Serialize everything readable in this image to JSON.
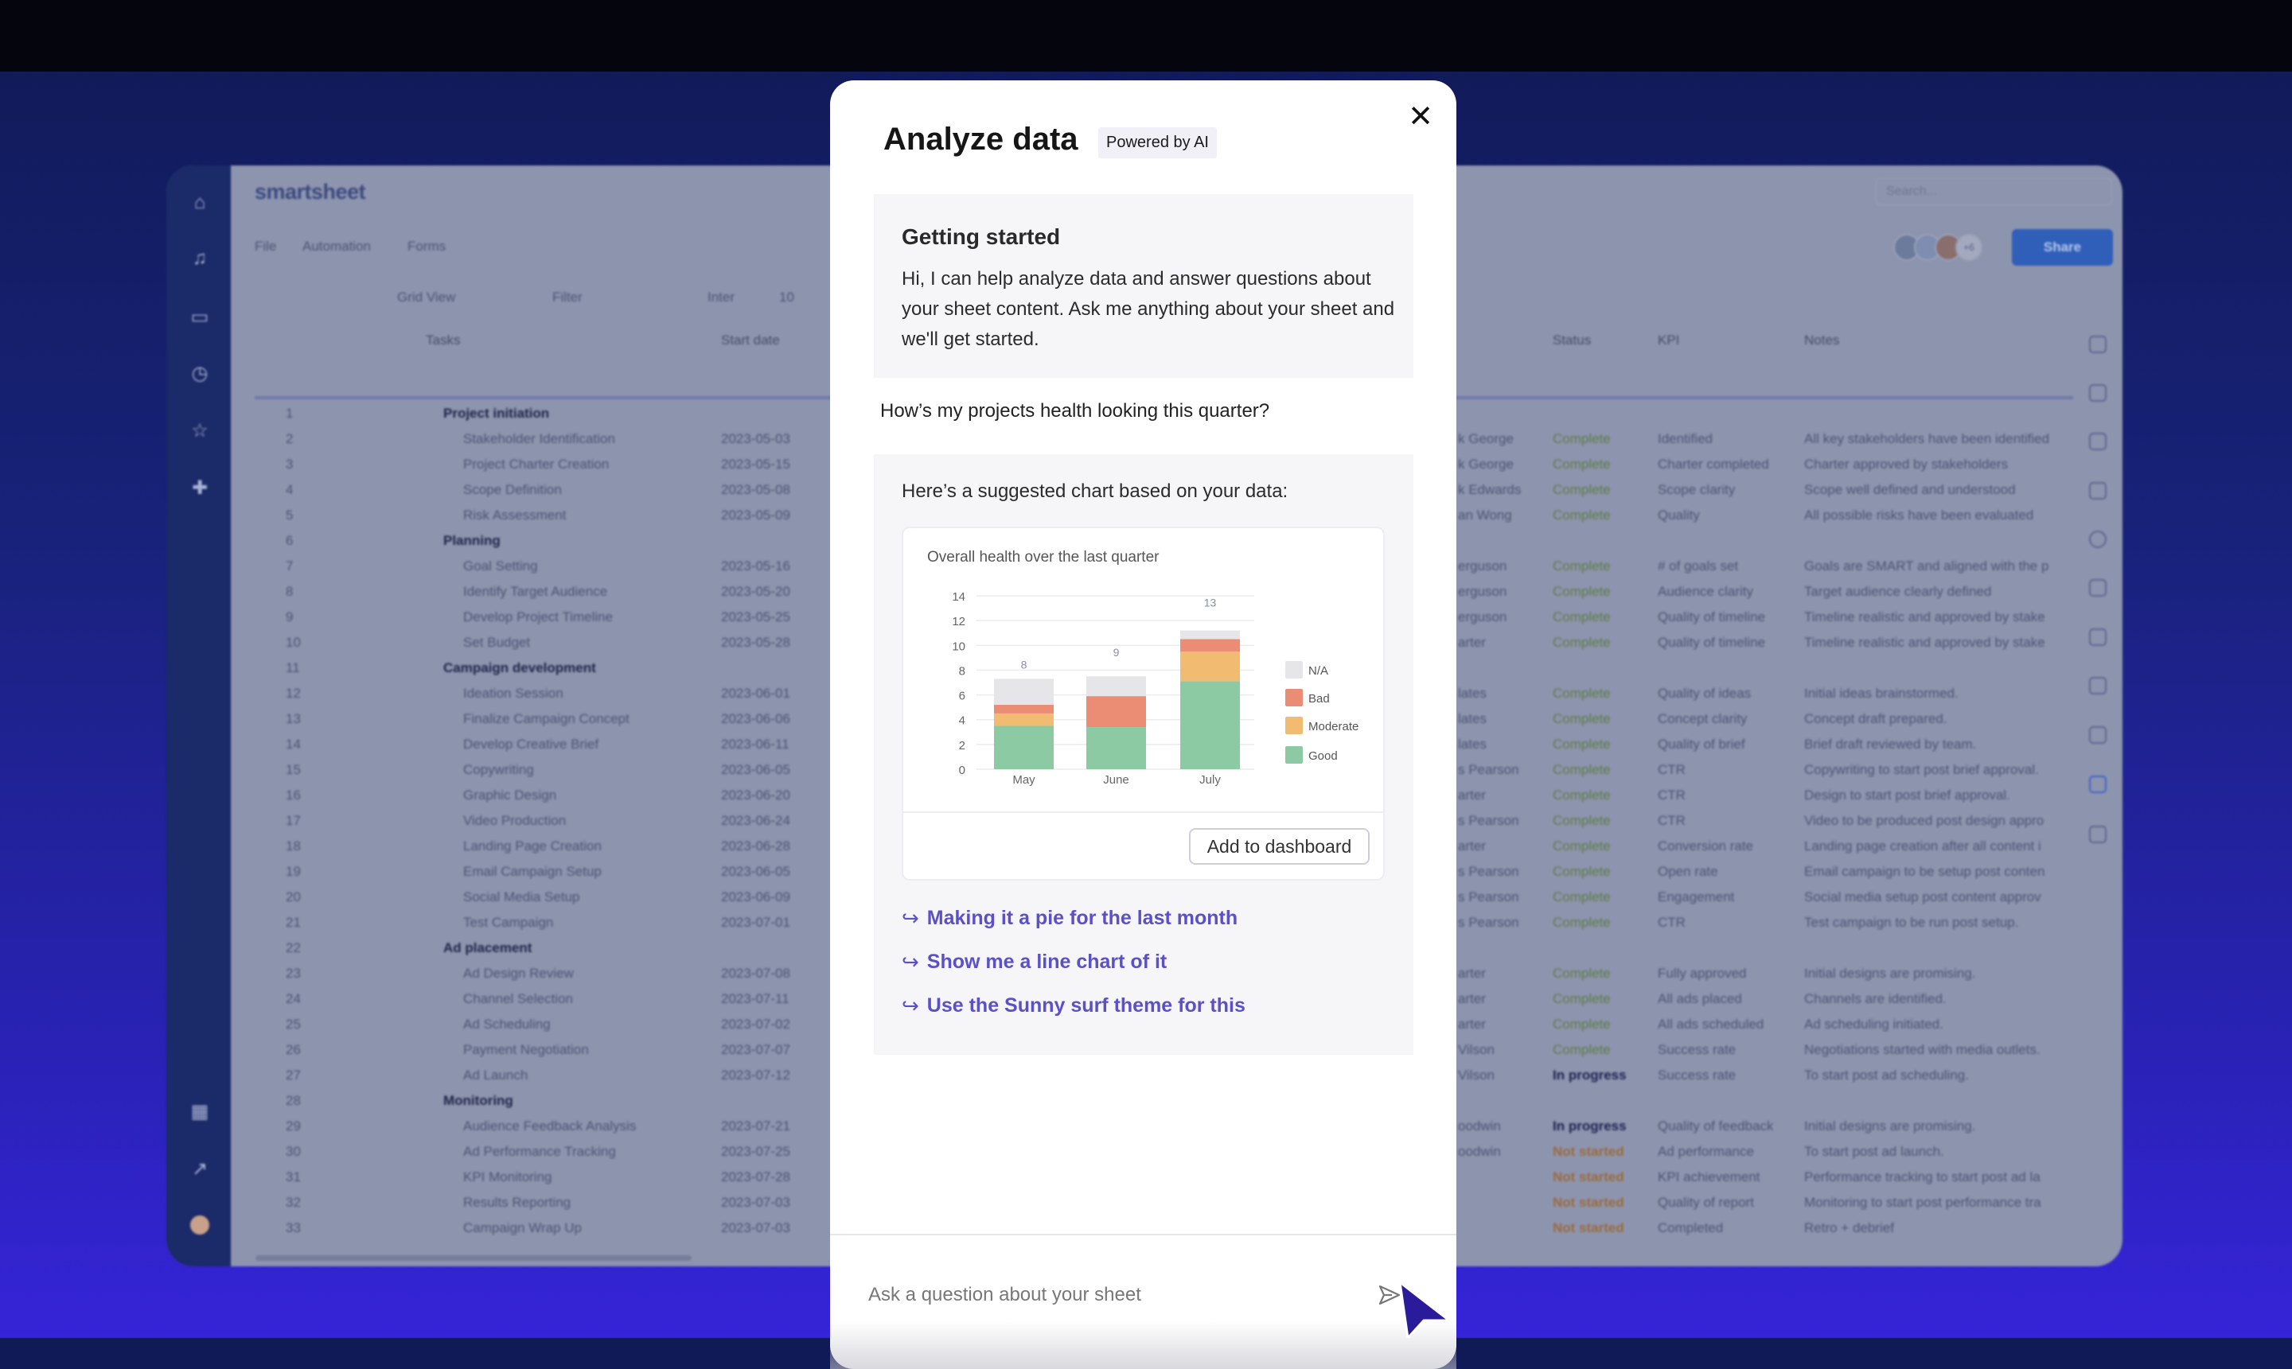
{
  "background_app": {
    "logo": "smartsheet",
    "menu": [
      "File",
      "Automation",
      "Forms"
    ],
    "toolbar": {
      "view": "Grid View",
      "filter": "Filter",
      "font": "Inter",
      "font_size": "10"
    },
    "search_placeholder": "Search...",
    "collaborators_more": "+6",
    "share_label": "Share",
    "columns": {
      "tasks": "Tasks",
      "start": "Start date",
      "status": "Status",
      "kpi": "KPI",
      "notes": "Notes"
    },
    "status_colors": {
      "Complete": "#5f7a45",
      "In progress": "#1b2250",
      "Not started": "#9a6b3c"
    },
    "rows": [
      {
        "n": "1",
        "task": "Project initiation",
        "group": true
      },
      {
        "n": "2",
        "task": "Stakeholder Identification",
        "start": "2023-05-03",
        "assignee": "k George",
        "status": "Complete",
        "kpi": "Identified",
        "notes": "All key stakeholders have been identified"
      },
      {
        "n": "3",
        "task": "Project Charter Creation",
        "start": "2023-05-15",
        "assignee": "k George",
        "status": "Complete",
        "kpi": "Charter completed",
        "notes": "Charter approved by stakeholders"
      },
      {
        "n": "4",
        "task": "Scope Definition",
        "start": "2023-05-08",
        "assignee": "k Edwards",
        "status": "Complete",
        "kpi": "Scope clarity",
        "notes": "Scope well defined and understood"
      },
      {
        "n": "5",
        "task": "Risk Assessment",
        "start": "2023-05-09",
        "assignee": "an Wong",
        "status": "Complete",
        "kpi": "Quality",
        "notes": "All possible risks have been evaluated"
      },
      {
        "n": "6",
        "task": "Planning",
        "group": true
      },
      {
        "n": "7",
        "task": "Goal Setting",
        "start": "2023-05-16",
        "assignee": "erguson",
        "status": "Complete",
        "kpi": "# of goals set",
        "notes": "Goals are SMART and aligned with the p"
      },
      {
        "n": "8",
        "task": "Identify Target Audience",
        "start": "2023-05-20",
        "assignee": "erguson",
        "status": "Complete",
        "kpi": "Audience clarity",
        "notes": "Target audience clearly defined"
      },
      {
        "n": "9",
        "task": "Develop Project Timeline",
        "start": "2023-05-25",
        "assignee": "erguson",
        "status": "Complete",
        "kpi": "Quality of timeline",
        "notes": "Timeline realistic and approved by stake"
      },
      {
        "n": "10",
        "task": "Set Budget",
        "start": "2023-05-28",
        "assignee": "arter",
        "status": "Complete",
        "kpi": "Quality of timeline",
        "notes": "Timeline realistic and approved by stake"
      },
      {
        "n": "11",
        "task": "Campaign development",
        "group": true
      },
      {
        "n": "12",
        "task": "Ideation Session",
        "start": "2023-06-01",
        "assignee": "lates",
        "status": "Complete",
        "kpi": "Quality of ideas",
        "notes": "Initial ideas brainstormed."
      },
      {
        "n": "13",
        "task": "Finalize Campaign Concept",
        "start": "2023-06-06",
        "assignee": "lates",
        "status": "Complete",
        "kpi": "Concept clarity",
        "notes": "Concept draft prepared."
      },
      {
        "n": "14",
        "task": "Develop Creative Brief",
        "start": "2023-06-11",
        "assignee": "lates",
        "status": "Complete",
        "kpi": "Quality of brief",
        "notes": "Brief draft reviewed by team."
      },
      {
        "n": "15",
        "task": "Copywriting",
        "start": "2023-06-05",
        "assignee": "s Pearson",
        "status": "Complete",
        "kpi": "CTR",
        "notes": "Copywriting to start post brief approval."
      },
      {
        "n": "16",
        "task": "Graphic Design",
        "start": "2023-06-20",
        "assignee": "arter",
        "status": "Complete",
        "kpi": "CTR",
        "notes": "Design to start post brief approval."
      },
      {
        "n": "17",
        "task": "Video Production",
        "start": "2023-06-24",
        "assignee": "s Pearson",
        "status": "Complete",
        "kpi": "CTR",
        "notes": "Video to be produced post design appro"
      },
      {
        "n": "18",
        "task": "Landing Page Creation",
        "start": "2023-06-28",
        "assignee": "arter",
        "status": "Complete",
        "kpi": "Conversion rate",
        "notes": "Landing page creation after all content i"
      },
      {
        "n": "19",
        "task": "Email Campaign Setup",
        "start": "2023-06-05",
        "assignee": "s Pearson",
        "status": "Complete",
        "kpi": "Open rate",
        "notes": "Email campaign to be setup post conten"
      },
      {
        "n": "20",
        "task": "Social Media Setup",
        "start": "2023-06-09",
        "assignee": "s Pearson",
        "status": "Complete",
        "kpi": "Engagement",
        "notes": "Social media setup post content approv"
      },
      {
        "n": "21",
        "task": "Test Campaign",
        "start": "2023-07-01",
        "assignee": "s Pearson",
        "status": "Complete",
        "kpi": "CTR",
        "notes": "Test campaign to be run post setup."
      },
      {
        "n": "22",
        "task": "Ad placement",
        "group": true
      },
      {
        "n": "23",
        "task": "Ad Design Review",
        "start": "2023-07-08",
        "assignee": "arter",
        "status": "Complete",
        "kpi": "Fully approved",
        "notes": "Initial designs are promising."
      },
      {
        "n": "24",
        "task": "Channel Selection",
        "start": "2023-07-11",
        "assignee": "arter",
        "status": "Complete",
        "kpi": "All ads placed",
        "notes": "Channels are identified."
      },
      {
        "n": "25",
        "task": "Ad Scheduling",
        "start": "2023-07-02",
        "assignee": "arter",
        "status": "Complete",
        "kpi": "All ads scheduled",
        "notes": "Ad scheduling initiated."
      },
      {
        "n": "26",
        "task": "Payment Negotiation",
        "start": "2023-07-07",
        "assignee": "Vilson",
        "status": "Complete",
        "kpi": "Success rate",
        "notes": "Negotiations started with media outlets."
      },
      {
        "n": "27",
        "task": "Ad Launch",
        "start": "2023-07-12",
        "assignee": "Vilson",
        "status": "In progress",
        "kpi": "Success rate",
        "notes": "To start post ad scheduling."
      },
      {
        "n": "28",
        "task": "Monitoring",
        "group": true
      },
      {
        "n": "29",
        "task": "Audience Feedback Analysis",
        "start": "2023-07-21",
        "assignee": "oodwin",
        "status": "In progress",
        "kpi": "Quality of feedback",
        "notes": "Initial designs are promising."
      },
      {
        "n": "30",
        "task": "Ad Performance Tracking",
        "start": "2023-07-25",
        "assignee": "oodwin",
        "status": "Not started",
        "kpi": "Ad performance",
        "notes": "To start post ad launch."
      },
      {
        "n": "31",
        "task": "KPI Monitoring",
        "start": "2023-07-28",
        "assignee": "",
        "status": "Not started",
        "kpi": "KPI achievement",
        "notes": "Performance tracking to start post ad la"
      },
      {
        "n": "32",
        "task": "Results Reporting",
        "start": "2023-07-03",
        "assignee": "",
        "status": "Not started",
        "kpi": "Quality of report",
        "notes": "Monitoring to start post performance tra"
      },
      {
        "n": "33",
        "task": "Campaign Wrap Up",
        "start": "2023-07-03",
        "assignee": "",
        "status": "Not started",
        "kpi": "Completed",
        "notes": "Retro + debrief"
      }
    ]
  },
  "modal": {
    "title": "Analyze data",
    "badge": "Powered by AI",
    "close_icon": "close-icon",
    "getting_started": {
      "heading": "Getting started",
      "body": "Hi, I can help analyze data and answer questions about your sheet content. Ask me anything about your sheet and we'll get started."
    },
    "user_question": "How’s my projects health looking this quarter?",
    "response_intro": "Here’s a suggested chart based on your data:",
    "add_to_dashboard": "Add to dashboard",
    "suggestions": [
      "Making it a pie for the last month",
      "Show me a line chart of it",
      "Use the Sunny surf theme for this"
    ],
    "input_placeholder": "Ask a question about your sheet",
    "accent_color": "#5b50c8"
  },
  "chart_data": {
    "type": "bar",
    "stacked": true,
    "title": "Overall health over the last quarter",
    "categories": [
      "May",
      "June",
      "July"
    ],
    "series": [
      {
        "name": "Good",
        "color": "#8ccaa4",
        "values": [
          3.5,
          3.4,
          7.1
        ]
      },
      {
        "name": "Moderate",
        "color": "#f2bb72",
        "values": [
          1.0,
          0,
          2.4
        ]
      },
      {
        "name": "Bad",
        "color": "#eb8d74",
        "values": [
          0.7,
          2.5,
          1.0
        ]
      },
      {
        "name": "N/A",
        "color": "#e6e6e8",
        "values": [
          2.1,
          1.6,
          0.7
        ]
      }
    ],
    "total_labels": [
      8,
      9,
      13
    ],
    "ylim": [
      0,
      14
    ],
    "yticks": [
      0,
      2,
      4,
      6,
      8,
      10,
      12,
      14
    ],
    "grid": true,
    "legend_placement": "right",
    "legend_order": [
      "N/A",
      "Bad",
      "Moderate",
      "Good"
    ],
    "xlabel": "",
    "ylabel": ""
  }
}
